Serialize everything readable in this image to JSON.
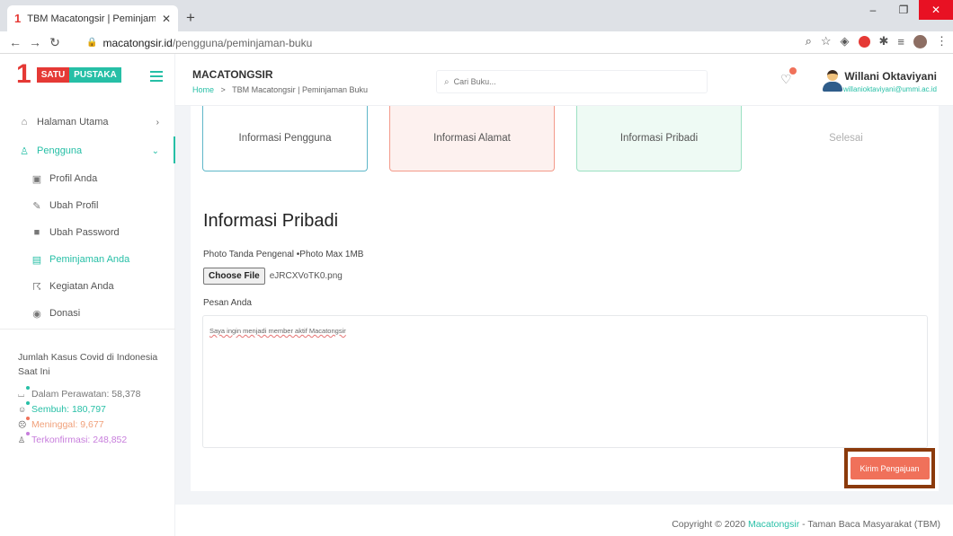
{
  "browser": {
    "tab_title": "TBM Macatongsir | Peminjaman",
    "tab_favicon": "1",
    "url_domain": "macatongsir.id",
    "url_path": "/pengguna/peminjaman-buku"
  },
  "brand": {
    "logo_one": "1",
    "logo_satu": "SATU",
    "logo_pustaka": "PUSTAKA",
    "colors": {
      "accent": "#26bfa6",
      "logo_red": "#e53935",
      "button": "#f0715a"
    }
  },
  "sidebar": {
    "items": [
      {
        "label": "Halaman Utama",
        "icon": "home-icon"
      },
      {
        "label": "Pengguna",
        "icon": "user-icon"
      },
      {
        "label": "Profil Anda",
        "icon": "id-card-icon"
      },
      {
        "label": "Ubah Profil",
        "icon": "edit-icon"
      },
      {
        "label": "Ubah Password",
        "icon": "lock-icon"
      },
      {
        "label": "Peminjaman Anda",
        "icon": "book-icon"
      },
      {
        "label": "Kegiatan Anda",
        "icon": "running-icon"
      },
      {
        "label": "Donasi",
        "icon": "donation-icon"
      }
    ],
    "covid": {
      "title": "Jumlah Kasus Covid di Indonesia Saat Ini",
      "stats": [
        {
          "label": "Dalam Perawatan: 58,378",
          "color": "#777777",
          "dot": "#26bfa6"
        },
        {
          "label": "Sembuh: 180,797",
          "color": "#26bfa6",
          "dot": "#26bfa6"
        },
        {
          "label": "Meninggal: 9,677",
          "color": "#f0a07a",
          "dot": "#f0715a"
        },
        {
          "label": "Terkonfirmasi: 248,852",
          "color": "#c77ddc",
          "dot": "#c77ddc"
        }
      ]
    }
  },
  "header": {
    "title": "MACATONGSIR",
    "breadcrumb_home": "Home",
    "breadcrumb_sep": ">",
    "breadcrumb_current": "TBM Macatongsir | Peminjaman Buku",
    "search_placeholder": "Cari Buku...",
    "user_name": "Willani Oktaviyani",
    "user_email": "willanioktaviyani@ummi.ac.id"
  },
  "steps": [
    {
      "label": "Informasi Pengguna"
    },
    {
      "label": "Informasi Alamat"
    },
    {
      "label": "Informasi Pribadi"
    },
    {
      "label": "Selesai"
    }
  ],
  "form": {
    "section_title": "Informasi Pribadi",
    "photo_label": "Photo Tanda Pengenal •Photo Max 1MB",
    "choose_file_label": "Choose File",
    "file_name": "eJRCXVoTK0.png",
    "message_label": "Pesan Anda",
    "message_value": "Saya ingin menjadi member aktif Macatongsir",
    "submit_label": "Kirim Pengajuan"
  },
  "footer": {
    "copyright_prefix": "Copyright © 2020",
    "copyright_link": "Macatongsir",
    "copyright_suffix": "- Taman Baca Masyarakat (TBM)"
  }
}
